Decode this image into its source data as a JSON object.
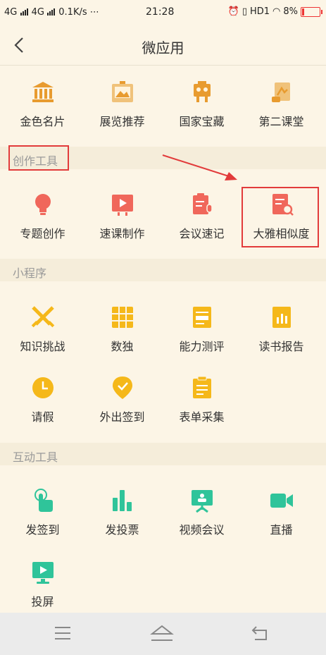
{
  "status": {
    "left": "4G 4G 0.1K/s",
    "time": "21:28",
    "right": "HD1",
    "battery": "8%"
  },
  "header": {
    "title": "微应用"
  },
  "top_items": [
    {
      "label": "金色名片",
      "color": "#e89b2f"
    },
    {
      "label": "展览推荐",
      "color": "#e89b2f"
    },
    {
      "label": "国家宝藏",
      "color": "#e89b2f"
    },
    {
      "label": "第二课堂",
      "color": "#e89b2f"
    }
  ],
  "sections": {
    "create": "创作工具",
    "mini": "小程序",
    "interact": "互动工具"
  },
  "create_items": [
    {
      "label": "专题创作"
    },
    {
      "label": "速课制作"
    },
    {
      "label": "会议速记"
    },
    {
      "label": "大雅相似度"
    }
  ],
  "mini_items": [
    {
      "label": "知识挑战"
    },
    {
      "label": "数独"
    },
    {
      "label": "能力测评"
    },
    {
      "label": "读书报告"
    },
    {
      "label": "请假"
    },
    {
      "label": "外出签到"
    },
    {
      "label": "表单采集"
    }
  ],
  "interact_items": [
    {
      "label": "发签到"
    },
    {
      "label": "发投票"
    },
    {
      "label": "视频会议"
    },
    {
      "label": "直播"
    },
    {
      "label": "投屏"
    }
  ],
  "colors": {
    "orange": "#e89b2f",
    "red": "#f0675b",
    "yellow": "#f5b81a",
    "green": "#2fc49a",
    "highlight": "#e23b3b"
  }
}
